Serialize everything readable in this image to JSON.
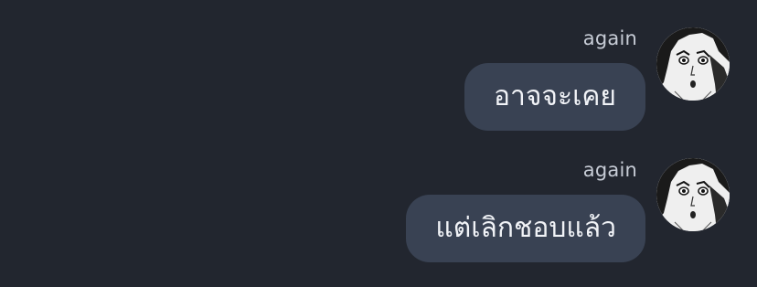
{
  "messages": [
    {
      "username": "again",
      "text": "อาจจะเคย"
    },
    {
      "username": "again",
      "text": "แต่เลิกชอบแล้ว"
    }
  ],
  "colors": {
    "background": "#22262f",
    "bubble": "#394253",
    "bubble_text": "#f1f3f7",
    "username_text": "#c7ccd6"
  },
  "icons": {
    "avatar": "manga-character-avatar-icon"
  }
}
